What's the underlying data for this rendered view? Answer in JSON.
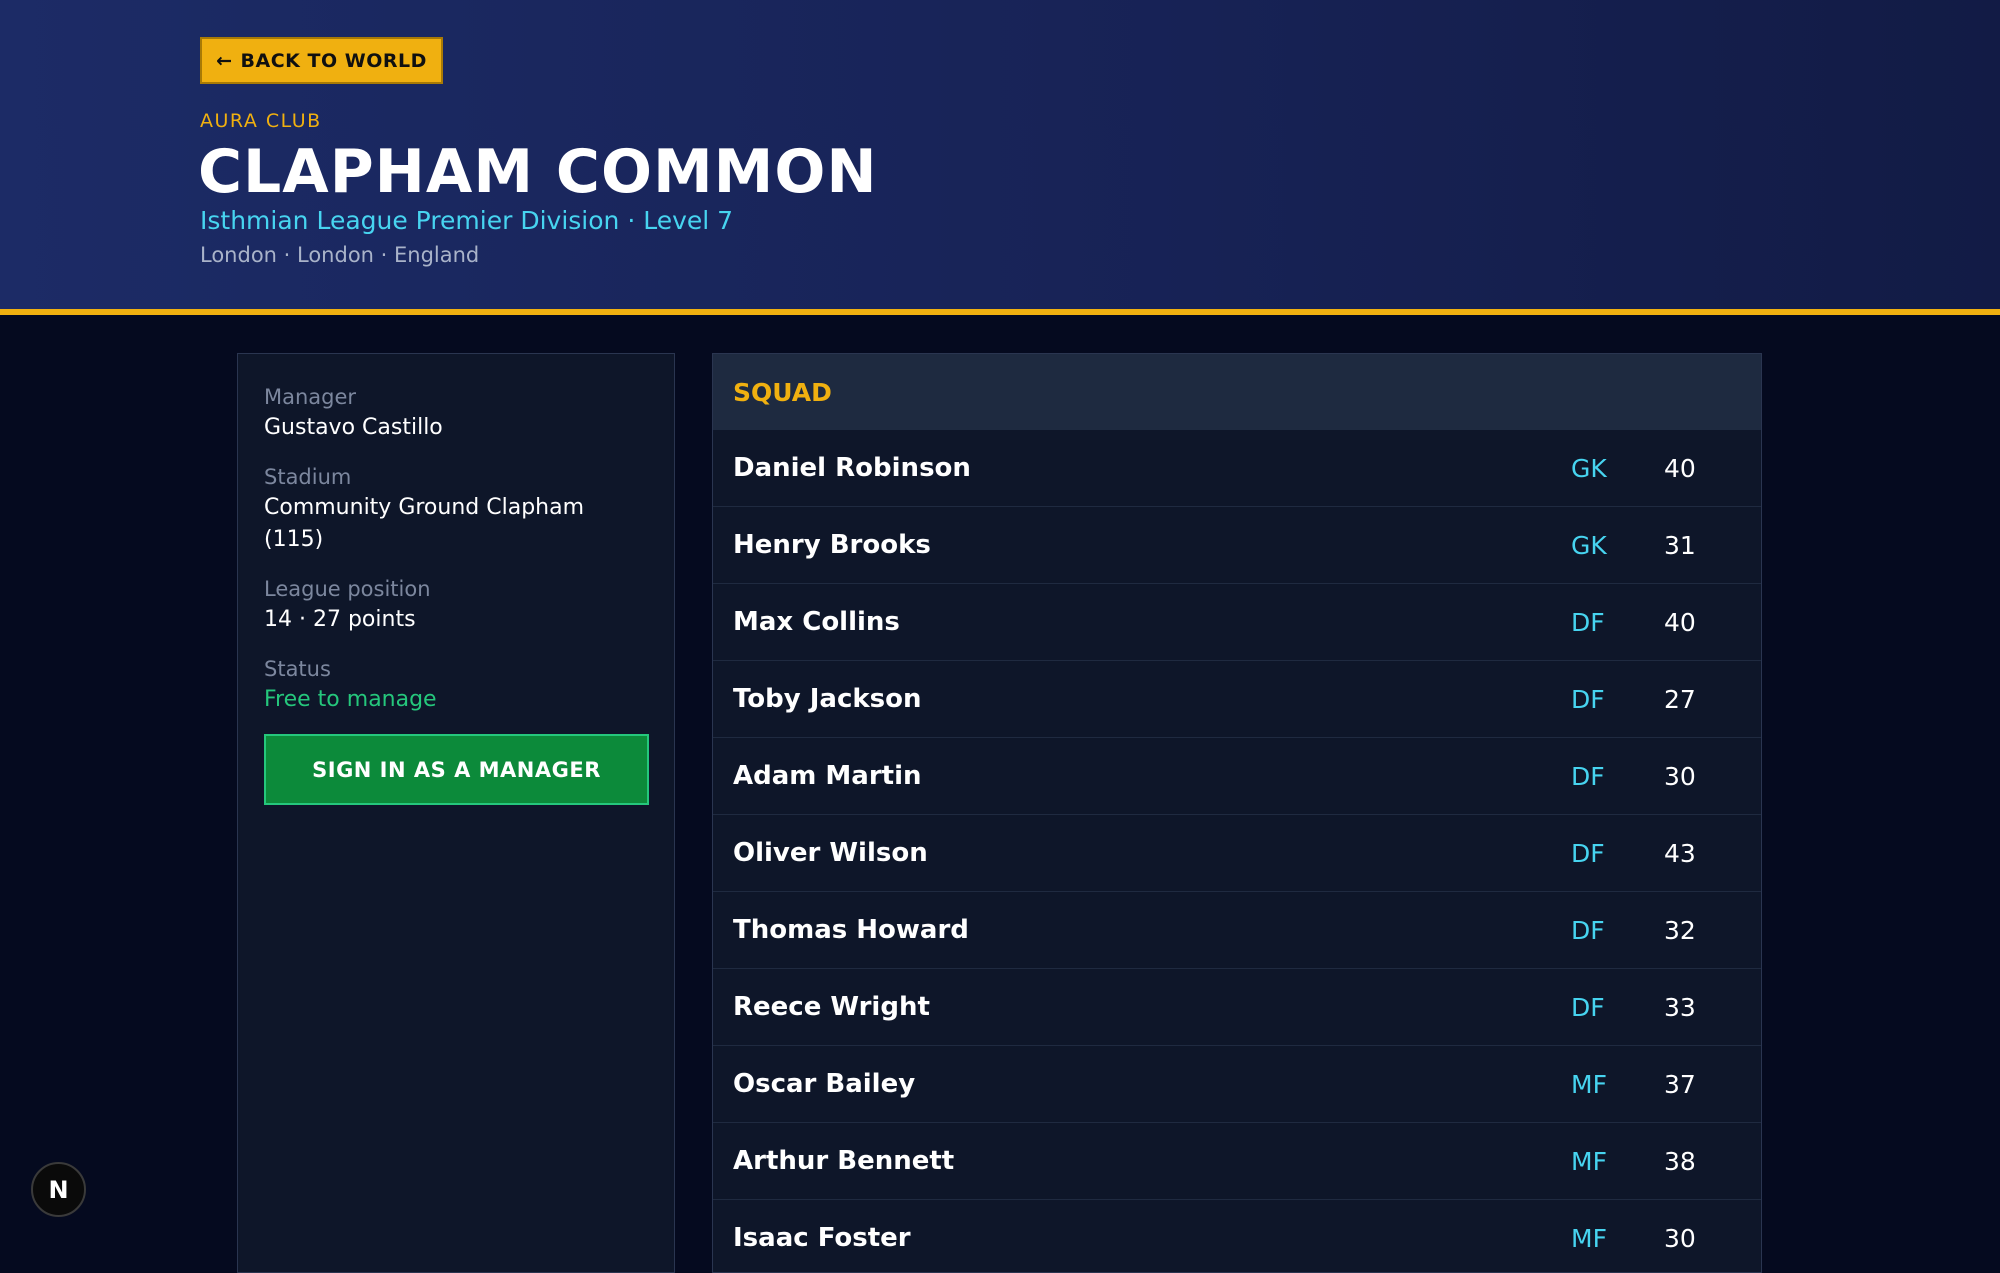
{
  "header": {
    "back_label": "BACK TO WORLD",
    "back_icon": "left-arrow-icon",
    "eyebrow": "AURA CLUB",
    "club_name": "CLAPHAM COMMON",
    "league": "Isthmian League Premier Division · Level 7",
    "location": "London · London · England"
  },
  "info": {
    "manager_label": "Manager",
    "manager_value": "Gustavo Castillo",
    "stadium_label": "Stadium",
    "stadium_value": "Community Ground Clapham (115)",
    "position_label": "League position",
    "position_value": "14 · 27 points",
    "status_label": "Status",
    "status_value": "Free to manage",
    "signin_label": "SIGN IN AS A MANAGER"
  },
  "squad": {
    "title": "SQUAD",
    "players": [
      {
        "name": "Daniel Robinson",
        "pos": "GK",
        "rating": "40"
      },
      {
        "name": "Henry Brooks",
        "pos": "GK",
        "rating": "31"
      },
      {
        "name": "Max Collins",
        "pos": "DF",
        "rating": "40"
      },
      {
        "name": "Toby Jackson",
        "pos": "DF",
        "rating": "27"
      },
      {
        "name": "Adam Martin",
        "pos": "DF",
        "rating": "30"
      },
      {
        "name": "Oliver Wilson",
        "pos": "DF",
        "rating": "43"
      },
      {
        "name": "Thomas Howard",
        "pos": "DF",
        "rating": "32"
      },
      {
        "name": "Reece Wright",
        "pos": "DF",
        "rating": "33"
      },
      {
        "name": "Oscar Bailey",
        "pos": "MF",
        "rating": "37"
      },
      {
        "name": "Arthur Bennett",
        "pos": "MF",
        "rating": "38"
      },
      {
        "name": "Isaac Foster",
        "pos": "MF",
        "rating": "30"
      }
    ]
  },
  "badge": {
    "label": "N"
  },
  "colors": {
    "accent": "#f0b010",
    "cyan": "#47d4f0",
    "green": "#25c77c",
    "header_bg": "#1c2b66",
    "page_bg": "#050a1f"
  }
}
